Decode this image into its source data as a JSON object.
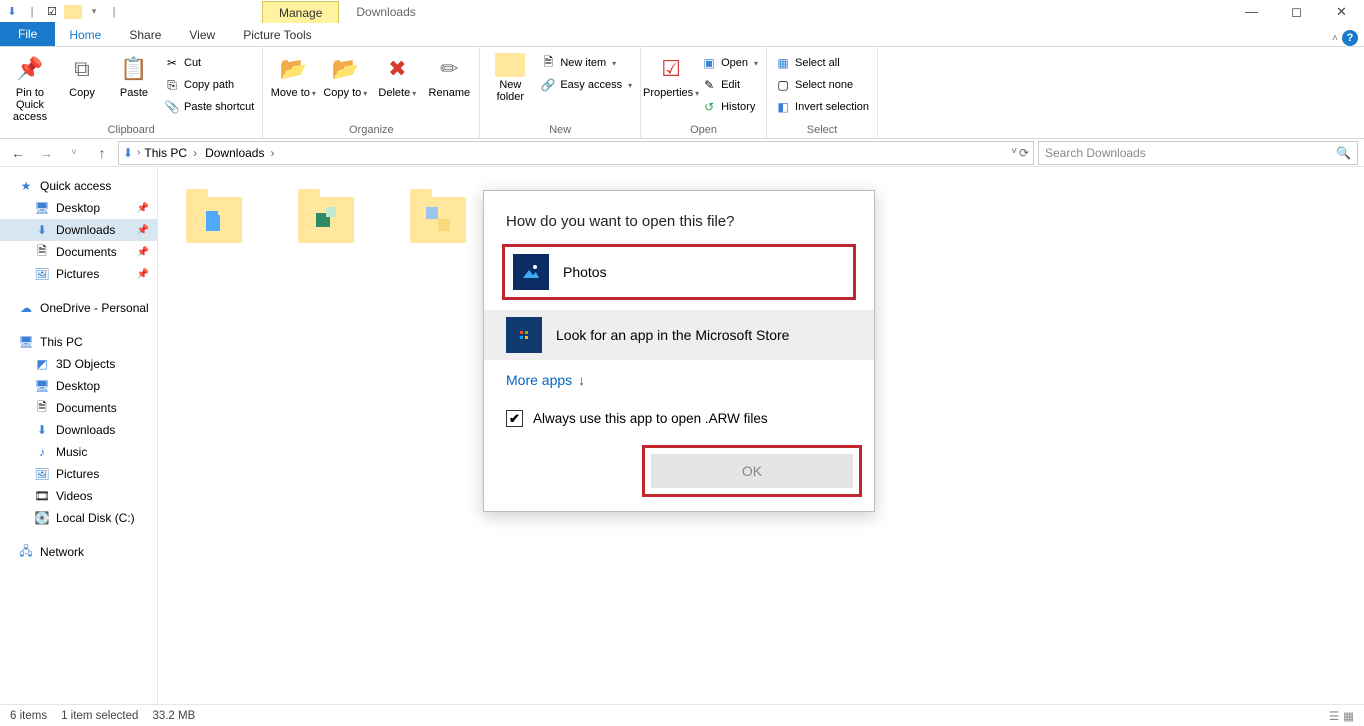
{
  "title_tabs": {
    "manage": "Manage",
    "location": "Downloads"
  },
  "ribbon_tabs": {
    "file": "File",
    "home": "Home",
    "share": "Share",
    "view": "View",
    "picture_tools": "Picture Tools"
  },
  "ribbon": {
    "clipboard": {
      "label": "Clipboard",
      "pin": "Pin to Quick access",
      "copy": "Copy",
      "paste": "Paste",
      "cut": "Cut",
      "copy_path": "Copy path",
      "paste_shortcut": "Paste shortcut"
    },
    "organize": {
      "label": "Organize",
      "move_to": "Move to",
      "copy_to": "Copy to",
      "delete": "Delete",
      "rename": "Rename"
    },
    "new": {
      "label": "New",
      "new_folder": "New folder",
      "new_item": "New item",
      "easy_access": "Easy access"
    },
    "open": {
      "label": "Open",
      "properties": "Properties",
      "open": "Open",
      "edit": "Edit",
      "history": "History"
    },
    "select": {
      "label": "Select",
      "select_all": "Select all",
      "select_none": "Select none",
      "invert": "Invert selection"
    }
  },
  "breadcrumb": {
    "this_pc": "This PC",
    "downloads": "Downloads"
  },
  "search_placeholder": "Search Downloads",
  "nav": {
    "quick_access": "Quick access",
    "desktop": "Desktop",
    "downloads": "Downloads",
    "documents": "Documents",
    "pictures": "Pictures",
    "onedrive": "OneDrive - Personal",
    "this_pc": "This PC",
    "objects3d": "3D Objects",
    "desktop2": "Desktop",
    "documents2": "Documents",
    "downloads2": "Downloads",
    "music": "Music",
    "pictures2": "Pictures",
    "videos": "Videos",
    "localdisk": "Local Disk (C:)",
    "network": "Network"
  },
  "dialog": {
    "title": "How do you want to open this file?",
    "photos": "Photos",
    "store": "Look for an app in the Microsoft Store",
    "more_apps": "More apps",
    "always": "Always use this app to open .ARW files",
    "ok": "OK"
  },
  "status": {
    "items": "6 items",
    "selected": "1 item selected",
    "size": "33.2 MB"
  }
}
